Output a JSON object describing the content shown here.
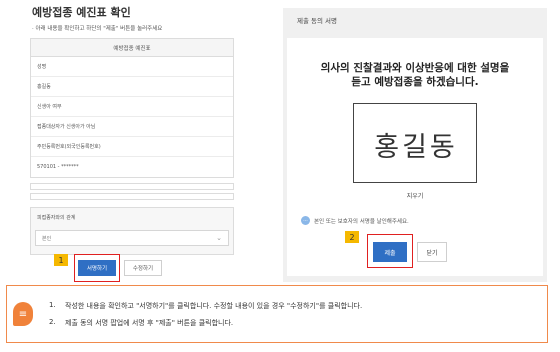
{
  "form": {
    "title": "예방접종 예진표 확인",
    "description": "· 아래 내용을 확인하고 하단의 \"제출\" 버튼을 눌러주세요",
    "table_header": "예방접종 예진표",
    "rows": [
      "성명",
      "홍길동",
      "신생아 여부",
      "접종대상자가 신생아가 아님",
      "주민등록번호(외국인등록번호)",
      "570101 - *******"
    ],
    "relation_label": "피접종자와의 관계",
    "relation_value": "본인",
    "sign_button": "서명하기",
    "edit_button": "수정하기"
  },
  "popup": {
    "title": "제출 동의 서명",
    "main_line1": "의사의 진찰결과와 이상반응에 대한 설명을",
    "main_line2": "듣고 예방접종을 하겠습니다.",
    "signature_text": "홍길동",
    "clear_label": "지우기",
    "notice": "본인 또는 보호자의 서명을 날인해주세요.",
    "submit_button": "제출",
    "close_button": "닫기"
  },
  "badges": {
    "one": "1",
    "two": "2"
  },
  "instructions": {
    "steps": [
      {
        "num": "1.",
        "text": "작성한 내용을 확인하고 \"서명하기\"를 클릭합니다. 수정할 내용이 있을 경우 \"수정하기\"를 클릭합니다."
      },
      {
        "num": "2.",
        "text": "제출 동의 서명 팝업에 서명 후 \"제출\" 버튼을 클릭합니다."
      }
    ]
  },
  "colors": {
    "primary_button": "#2f6fc4",
    "highlight": "#e02020",
    "badge": "#f5b800",
    "callout_border": "#f08a4b"
  },
  "icons": {
    "chevron": "chevron-down-icon",
    "notice": "chat-bubble-icon",
    "callout": "note-icon"
  }
}
